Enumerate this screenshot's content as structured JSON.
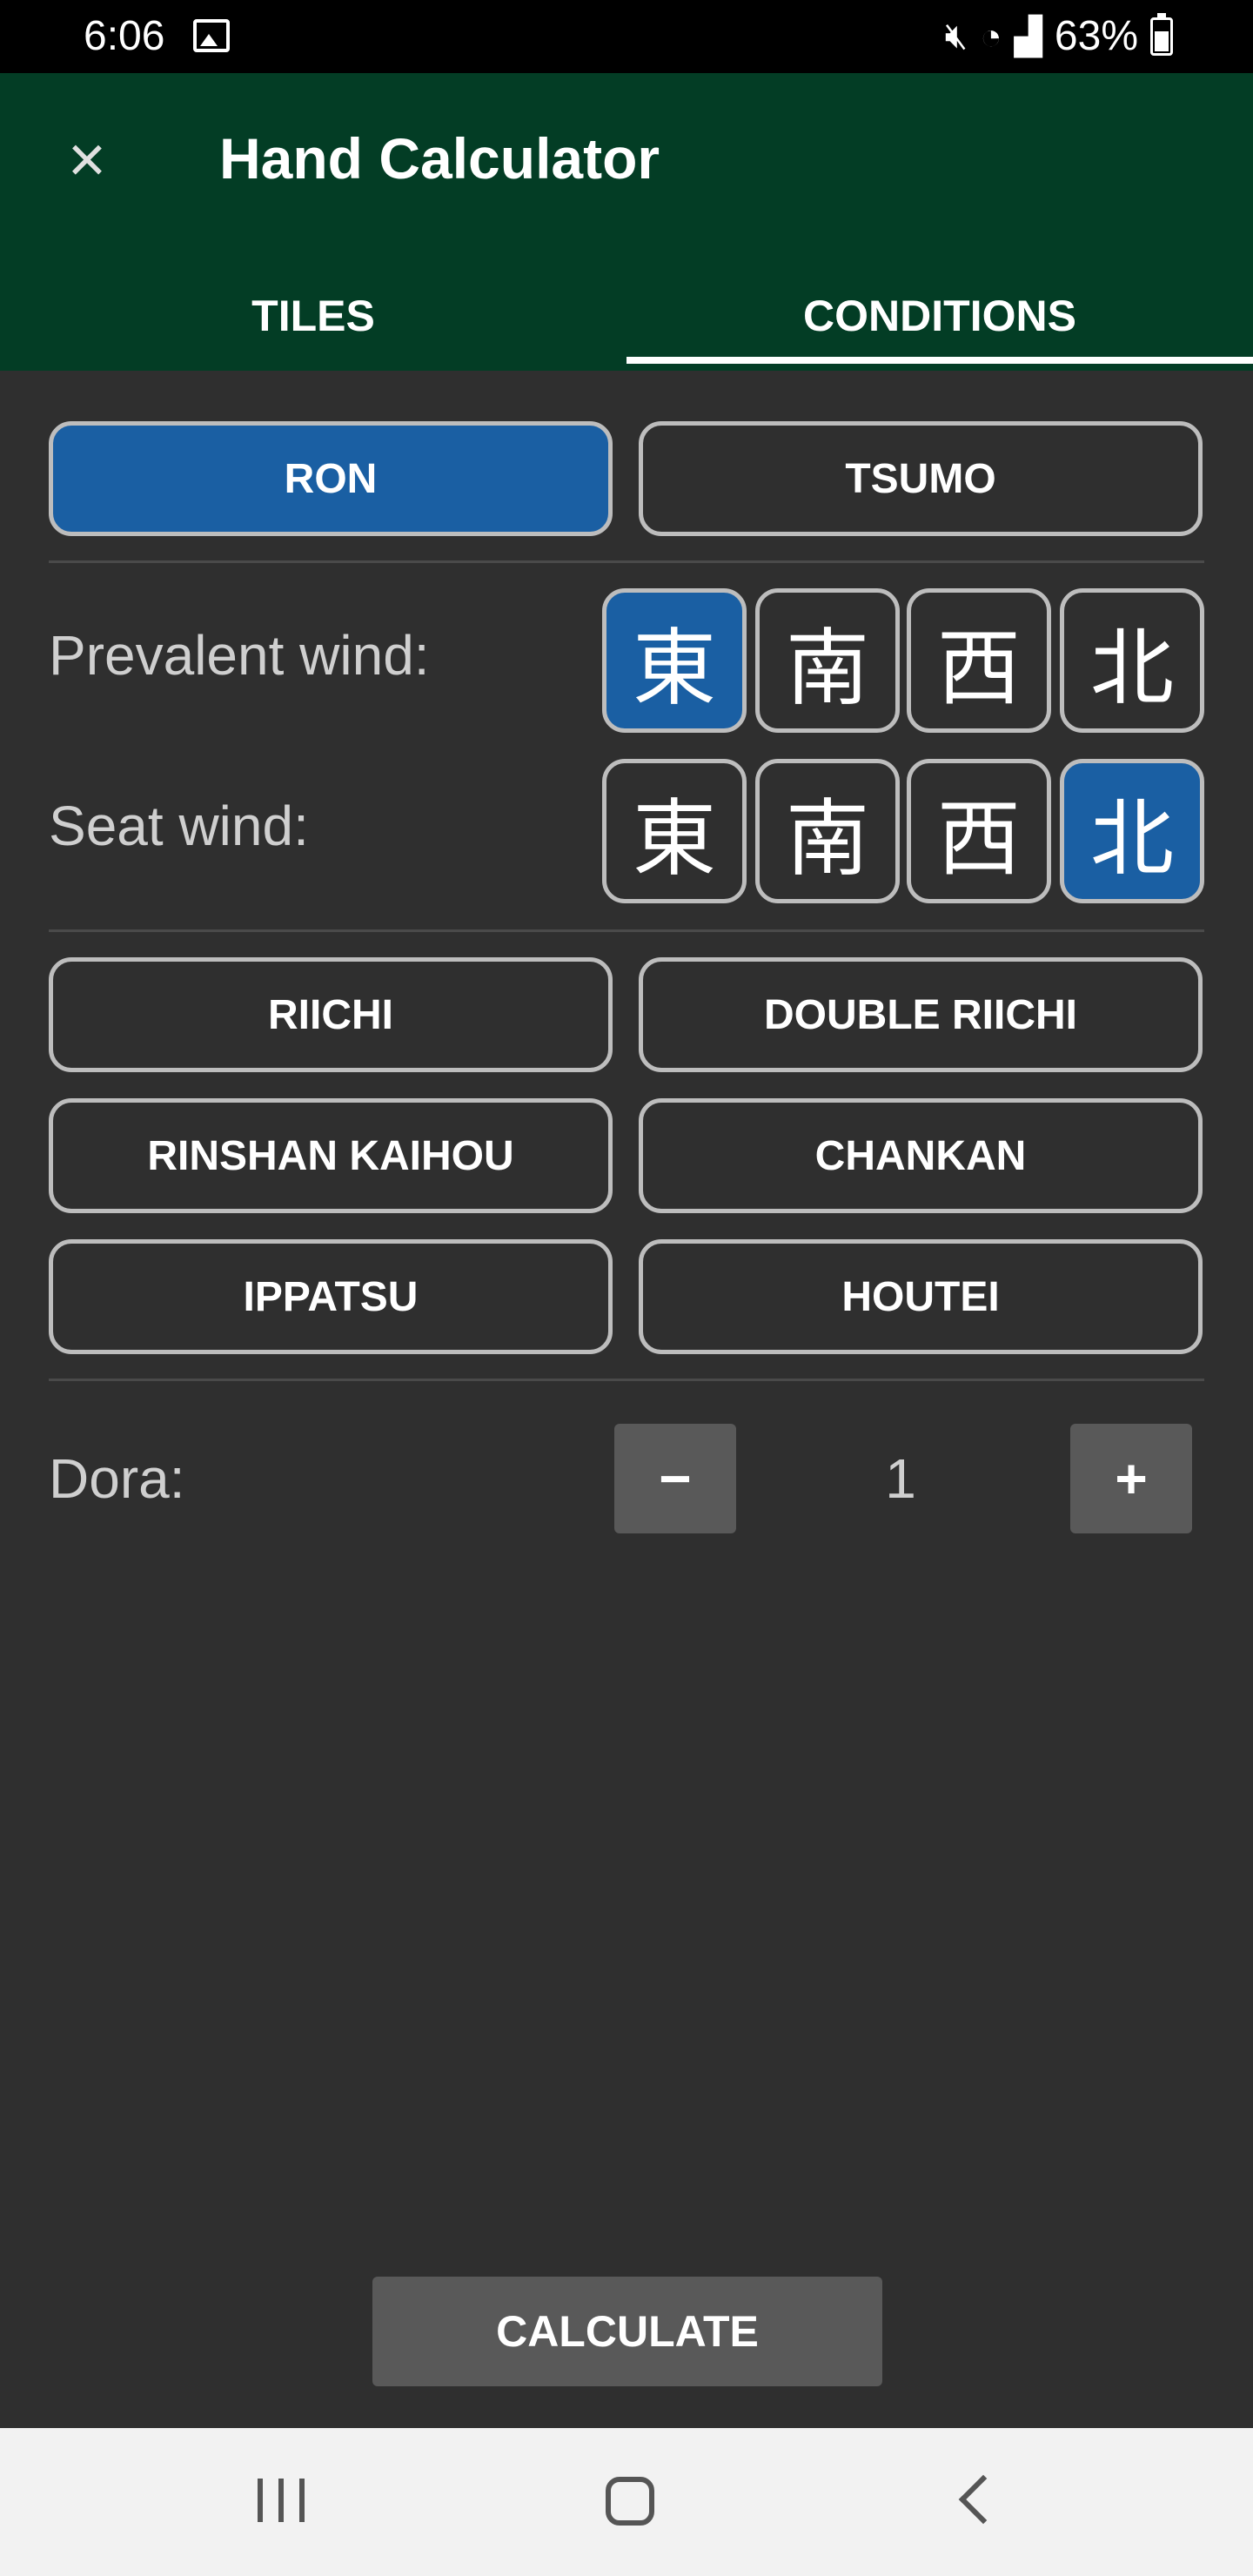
{
  "status_bar": {
    "time": "6:06",
    "icons": [
      "image-icon",
      "mute-icon",
      "wifi-icon",
      "signal-icon"
    ],
    "battery": "63%"
  },
  "app_bar": {
    "title": "Hand Calculator",
    "close_icon": "×"
  },
  "tabs": [
    {
      "label": "TILES",
      "selected": false
    },
    {
      "label": "CONDITIONS",
      "selected": true
    }
  ],
  "win_type": {
    "ron": "RON",
    "tsumo": "TSUMO",
    "selected": "RON"
  },
  "winds": {
    "prevalent_label": "Prevalent wind:",
    "seat_label": "Seat wind:",
    "tiles": [
      "東",
      "南",
      "西",
      "北"
    ],
    "prevalent_selected": "東",
    "seat_selected": "北"
  },
  "yaku_buttons": {
    "riichi": "RIICHI",
    "double_riichi": "DOUBLE RIICHI",
    "rinshan_kaihou": "RINSHAN KAIHOU",
    "chankan": "CHANKAN",
    "ippatsu": "IPPATSU",
    "houtei": "HOUTEI"
  },
  "dora": {
    "label": "Dora:",
    "minus": "−",
    "plus": "+",
    "value": "1"
  },
  "calculate_label": "CALCULATE",
  "colors": {
    "app_bar": "#033d25",
    "background": "#2f2f2f",
    "selected": "#1a5fa3",
    "border": "#bdbdbd",
    "stepper": "#595959"
  }
}
